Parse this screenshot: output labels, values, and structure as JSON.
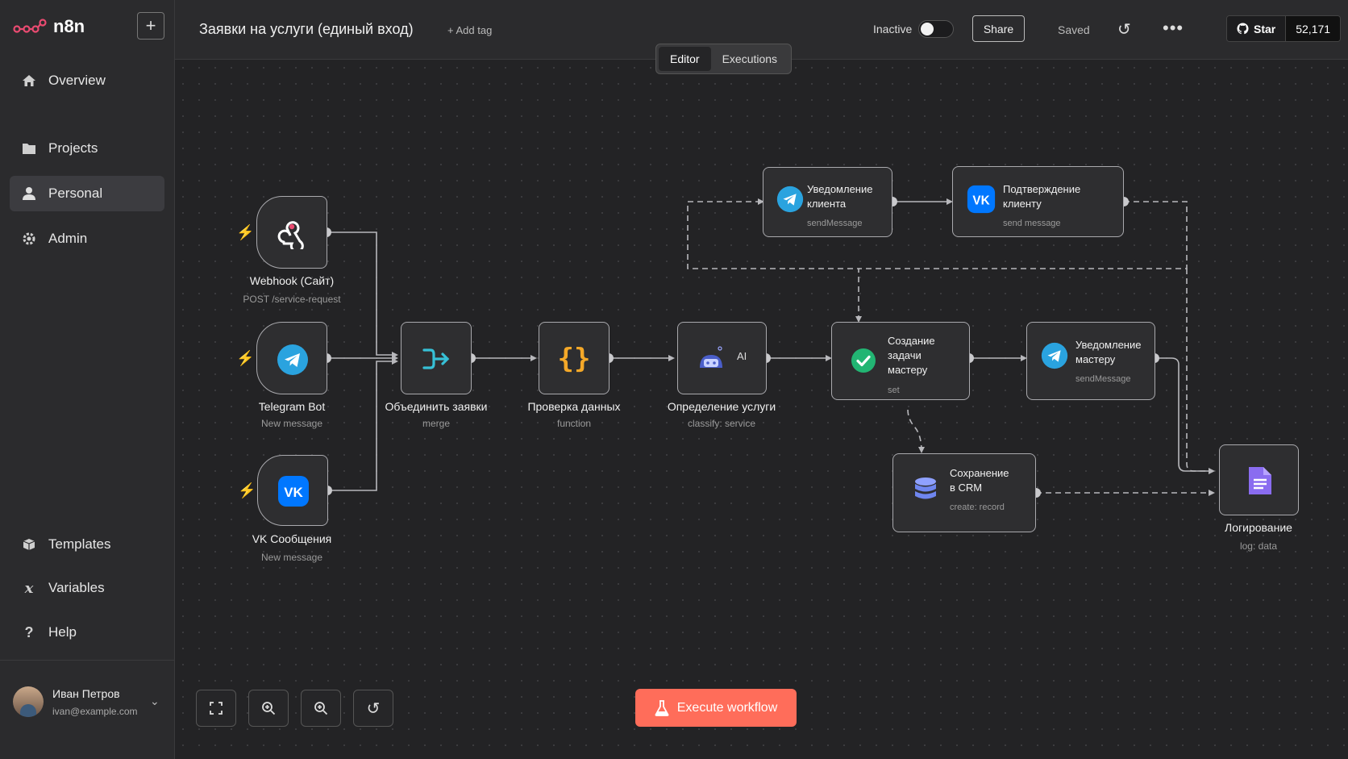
{
  "app": {
    "name": "n8n"
  },
  "sidebar": {
    "add_label": "+",
    "items": [
      {
        "label": "Overview",
        "icon": "home-icon"
      },
      {
        "label": "Projects",
        "icon": "folder-icon"
      },
      {
        "label": "Personal",
        "icon": "user-icon",
        "active": true
      },
      {
        "label": "Admin",
        "icon": "gear-icon"
      },
      {
        "label": "Templates",
        "icon": "box-icon"
      },
      {
        "label": "Variables",
        "icon": "variable-icon"
      },
      {
        "label": "Help",
        "icon": "help-icon"
      }
    ],
    "user": {
      "name": "Иван Петров",
      "email": "ivan@example.com"
    }
  },
  "header": {
    "title": "Заявки на услуги (единый вход)",
    "add_tag": "+ Add tag",
    "status_label": "Inactive",
    "share_label": "Share",
    "saved_label": "Saved",
    "star_label": "Star",
    "star_count": "52,171",
    "tabs": [
      {
        "label": "Editor",
        "active": true
      },
      {
        "label": "Executions"
      }
    ]
  },
  "nodes": {
    "webhook": {
      "name": "Webhook (Сайт)",
      "sub": "POST /service-request"
    },
    "telegram": {
      "name": "Telegram Bot",
      "sub": "New message"
    },
    "vk": {
      "name": "VK Сообщения",
      "sub": "New message"
    },
    "merge": {
      "name": "Объединить заявки",
      "sub": "merge"
    },
    "check": {
      "name": "Проверка данных",
      "sub": "function"
    },
    "classify": {
      "name": "Определение услуги",
      "sub": "classify: service",
      "badge": "AI"
    },
    "notify_client": {
      "line1": "Уведомление",
      "line2": "клиента",
      "sub": "sendMessage"
    },
    "confirm_client": {
      "line1": "Подтверждение",
      "line2": "клиенту",
      "sub": "send message"
    },
    "create_task": {
      "line1": "Создание",
      "line2": "задачи",
      "line3": "мастеру",
      "sub": "set"
    },
    "notify_master": {
      "line1": "Уведомление",
      "line2": "мастеру",
      "sub": "sendMessage"
    },
    "crm": {
      "line1": "Сохранение",
      "line2": "в CRM",
      "sub": "create: record"
    },
    "log": {
      "name": "Логирование",
      "sub": "log: data"
    }
  },
  "footer": {
    "execute_label": "Execute workflow"
  },
  "colors": {
    "accent": "#ff6d5a",
    "telegram": "#2aa3df",
    "vk": "#0077ff",
    "merge": "#37c0d6",
    "code": "#f4a828",
    "success": "#22b573",
    "db": "#6f86ef",
    "log": "#8a6cf0"
  }
}
